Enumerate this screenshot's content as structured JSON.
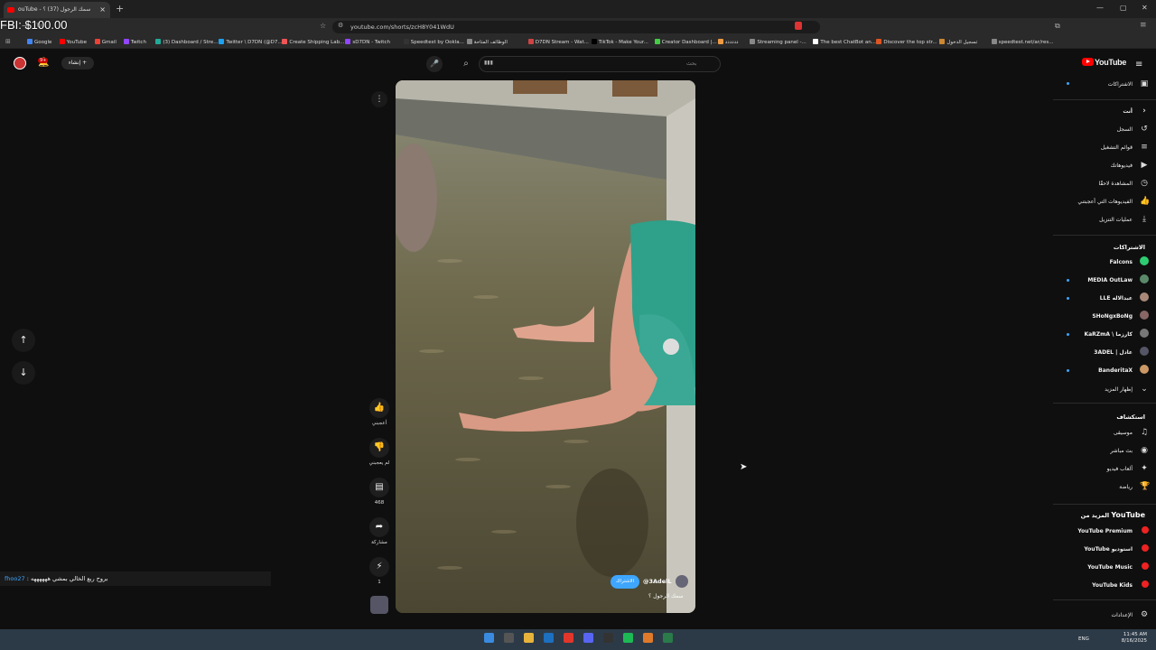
{
  "browser": {
    "tab_title": "ouTube - سمك الرجول (37) ؟",
    "url": "youtube.com/shorts/zcH8Y041WdU",
    "bookmarks": [
      "Google",
      "YouTube",
      "Gmail",
      "Twitch",
      "(3) Dashboard / Stre...",
      "Twitter \\ D7DN (@D7...",
      "Create Shipping Lab...",
      "sD7DN - Twitch",
      "Speedtest by Ookla...",
      "الوظائف المتاحة",
      "D7DN Stream - Wat...",
      "TikTok - Make Your...",
      "Creator Dashboard |...",
      "دددددد",
      "Streaming panel -...",
      "The best ChatBot an...",
      "Discover the top str...",
      "تسجيل الدخول",
      "speedtest.net/ar/res..."
    ]
  },
  "overlay": {
    "text": "FBI: $100.00"
  },
  "header": {
    "logo_text": "YouTube",
    "search_placeholder": "بحث",
    "search_value": "▮▮▮",
    "create_label": "إنشاء",
    "notif_count": "9+"
  },
  "sidebar": {
    "subs_top": "الاشتراكات",
    "you_label": "أنت",
    "you_items": [
      {
        "label": "السجل",
        "icon": "history-icon",
        "glyph": "↺"
      },
      {
        "label": "قوائم التشغيل",
        "icon": "playlist-icon",
        "glyph": "≡"
      },
      {
        "label": "فيديوهاتك",
        "icon": "your-videos-icon",
        "glyph": "▶"
      },
      {
        "label": "المشاهدة لاحقًا",
        "icon": "watch-later-icon",
        "glyph": "◷"
      },
      {
        "label": "الفيديوهات التي أعجبتني",
        "icon": "like-icon",
        "glyph": "👍"
      },
      {
        "label": "عمليات التنزيل",
        "icon": "download-icon",
        "glyph": "⤓"
      }
    ],
    "subs_heading": "الاشتراكات",
    "subscriptions": [
      {
        "name": "Falcons",
        "color": "#2ecc71",
        "dot": false
      },
      {
        "name": "MEDIA OutLaw",
        "color": "#5a8a6a",
        "dot": true
      },
      {
        "name": "LLE عبدالاله",
        "color": "#a87",
        "dot": true
      },
      {
        "name": "SHoNgxBoNg",
        "color": "#866",
        "dot": false
      },
      {
        "name": "KaRZmA \\ كارزما",
        "color": "#777",
        "dot": true
      },
      {
        "name": "3ADEL | عادل",
        "color": "#556",
        "dot": false
      },
      {
        "name": "BanderitaX",
        "color": "#c96",
        "dot": true
      }
    ],
    "show_more": "إظهار المزيد",
    "explore_heading": "استكشاف",
    "explore_items": [
      {
        "label": "موسيقى",
        "icon": "music-icon",
        "glyph": "♫"
      },
      {
        "label": "بث مباشر",
        "icon": "live-icon",
        "glyph": "◉"
      },
      {
        "label": "ألعاب فيديو",
        "icon": "gaming-icon",
        "glyph": "✦"
      },
      {
        "label": "رياضة",
        "icon": "sports-icon",
        "glyph": "🏆"
      }
    ],
    "more_heading_yt": "YouTube",
    "more_heading_ar": "المزيد من",
    "more_items": [
      "YouTube Premium",
      "YouTube استوديو",
      "YouTube Music",
      "YouTube Kids"
    ],
    "settings": "الإعدادات"
  },
  "short": {
    "like_label": "أعجبني",
    "dislike_label": "لم يعجبني",
    "comments_count": "468",
    "share_label": "مشاركة",
    "remix_count": "1",
    "subscribe_label": "الاشتراك",
    "channel": "@3AdelL",
    "title": "سمك الرجول ؟"
  },
  "chat": {
    "user": "fhoo27",
    "message": ": بروح ربع الخالي بمشي ههههههه"
  },
  "taskbar": {
    "lang": "ENG",
    "time": "11:45 AM",
    "date": "8/16/2025"
  }
}
